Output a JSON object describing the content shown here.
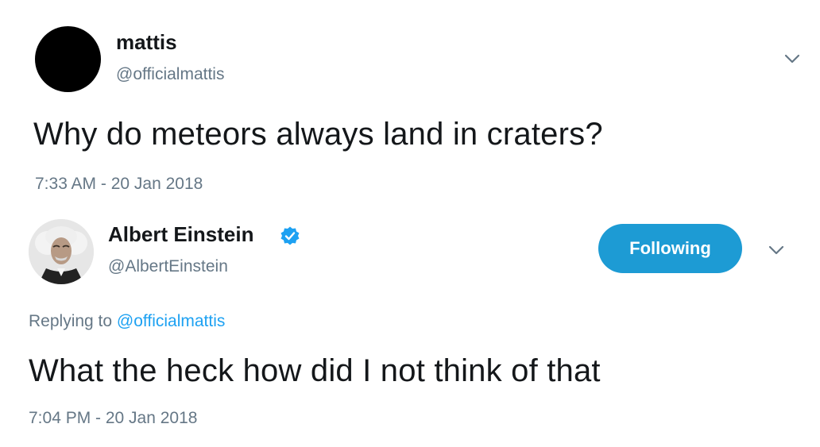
{
  "tweets": [
    {
      "name": "mattis",
      "handle": "@officialmattis",
      "text": "Why do meteors always land in craters?",
      "timestamp": "7:33 AM - 20 Jan 2018",
      "avatar_color": "#000000"
    },
    {
      "name": "Albert Einstein",
      "handle": "@AlbertEinstein",
      "verified": true,
      "follow_button_label": "Following",
      "replying_prefix": "Replying to",
      "replying_to": "@officialmattis",
      "text": "What the heck how did I not think of that",
      "timestamp": "7:04 PM - 20 Jan 2018"
    }
  ],
  "icons": {
    "menu": "chevron-down-icon",
    "verified": "verified-badge-icon"
  },
  "colors": {
    "accent": "#1d9bd4",
    "link": "#1da1f2",
    "secondary_text": "#657786",
    "primary_text": "#14171a"
  }
}
